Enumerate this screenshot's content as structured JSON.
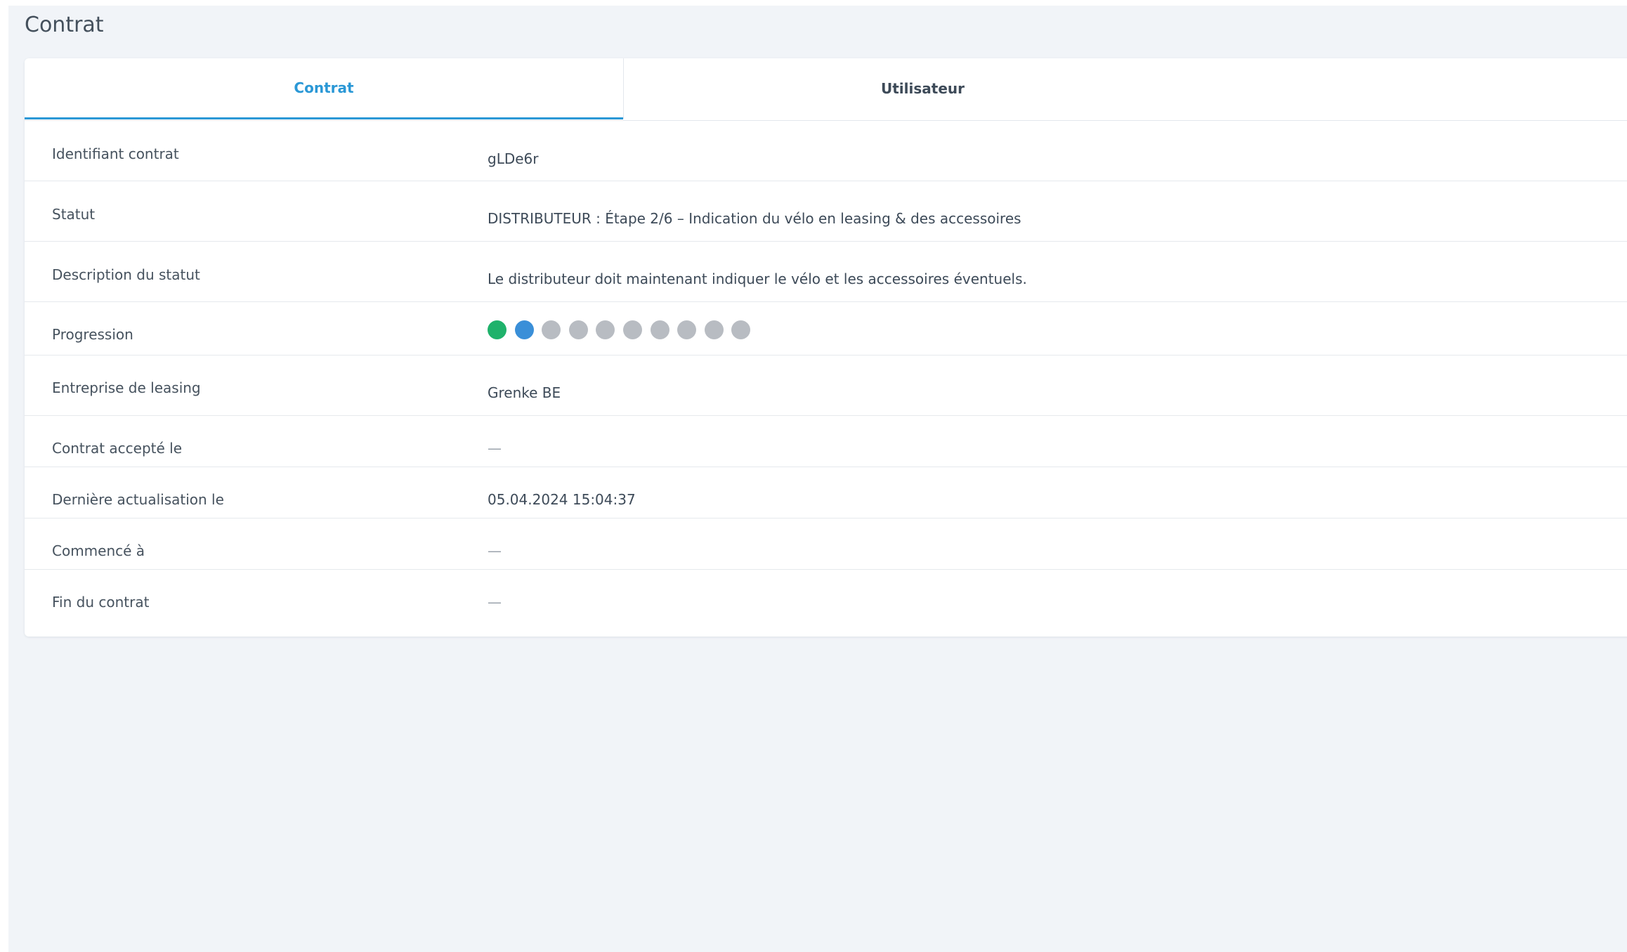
{
  "page": {
    "title": "Contrat"
  },
  "tabs": [
    {
      "label": "Contrat",
      "active": true
    },
    {
      "label": "Utilisateur",
      "active": false
    }
  ],
  "fields": {
    "contract_id": {
      "label": "Identifiant contrat",
      "value": "gLDe6r"
    },
    "status": {
      "label": "Statut",
      "value": "DISTRIBUTEUR : Étape 2/6 – Indication du vélo en leasing & des accessoires"
    },
    "status_description": {
      "label": "Description du statut",
      "value": "Le distributeur doit maintenant indiquer le vélo et les accessoires éventuels."
    },
    "progression": {
      "label": "Progression",
      "steps": [
        "done",
        "current",
        "todo",
        "todo",
        "todo",
        "todo",
        "todo",
        "todo",
        "todo",
        "todo"
      ]
    },
    "leasing_company": {
      "label": "Entreprise de leasing",
      "value": "Grenke BE"
    },
    "accepted_on": {
      "label": "Contrat accepté le",
      "value": "—"
    },
    "last_update": {
      "label": "Dernière actualisation le",
      "value": "05.04.2024 15:04:37"
    },
    "started_at": {
      "label": "Commencé à",
      "value": "—"
    },
    "contract_end": {
      "label": "Fin du contrat",
      "value": "—"
    }
  },
  "colors": {
    "accent": "#2b98d6",
    "step_done": "#1fb26b",
    "step_current": "#3a8fd8",
    "step_todo": "#b8bcc2"
  }
}
